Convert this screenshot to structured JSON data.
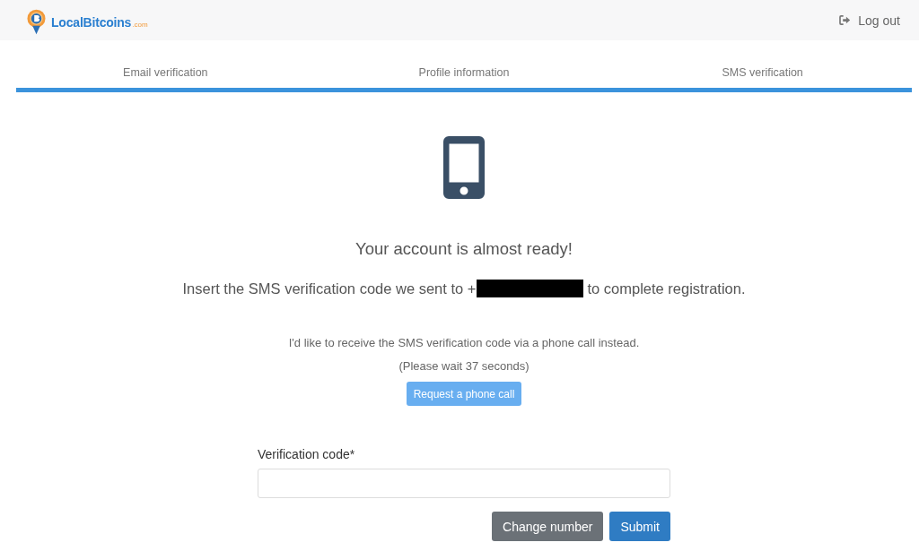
{
  "header": {
    "logo": {
      "name": "LocalBitcoins",
      "domain": ".com"
    },
    "logout": {
      "label": "Log out"
    }
  },
  "steps": [
    {
      "label": "Email verification"
    },
    {
      "label": "Profile information"
    },
    {
      "label": "SMS verification"
    }
  ],
  "progress": {
    "level": 1
  },
  "main": {
    "title": "Your account is almost ready!",
    "instruction": {
      "before": "Insert the SMS verification code we sent to +",
      "redacted": true,
      "after": "to complete registration."
    },
    "call_note": "I'd like to receive the SMS verification code via a phone call instead.",
    "wait_note": "(Please wait 37 seconds)",
    "call_button": {
      "label": "Request a phone call",
      "disabled": true
    },
    "field": {
      "label": "Verification code*"
    },
    "actions": [
      {
        "label": "Change number",
        "kind": "secondary"
      },
      {
        "label": "Submit",
        "kind": "primary"
      }
    ]
  }
}
